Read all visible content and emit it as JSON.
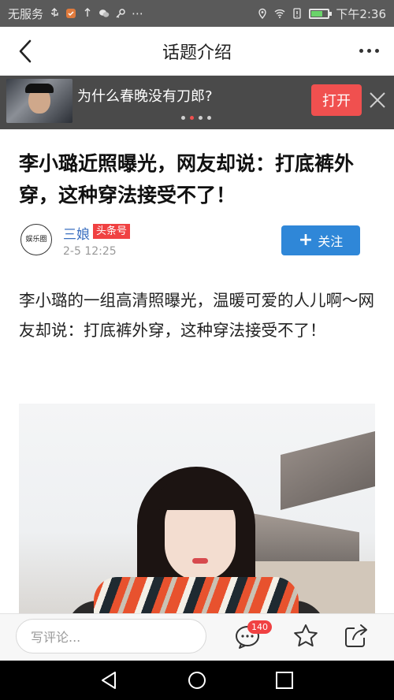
{
  "status_bar": {
    "left_text": "无服务",
    "time": "下午2:36",
    "battery_percent": 70
  },
  "title_bar": {
    "title": "话题介绍"
  },
  "promo": {
    "text": "为什么春晚没有刀郎?",
    "open_label": "打开",
    "active_dot": 2,
    "dot_count": 4
  },
  "article": {
    "headline": "李小璐近照曝光，网友却说：打底裤外穿，这种穿法接受不了！",
    "author": {
      "avatar_text": "娱乐圈",
      "name": "三娘",
      "tag": "头条号",
      "time": "2-5 12:25",
      "follow_label": "关注"
    },
    "body": "李小璐的一组高清照曝光，温暖可爱的人儿啊～网友却说：打底裤外穿，这种穿法接受不了！"
  },
  "bottom_bar": {
    "comment_placeholder": "写评论...",
    "comment_count": "140"
  },
  "colors": {
    "accent_red": "#f04142",
    "follow_blue": "#2f87d8",
    "author_blue": "#3a6fc0"
  }
}
